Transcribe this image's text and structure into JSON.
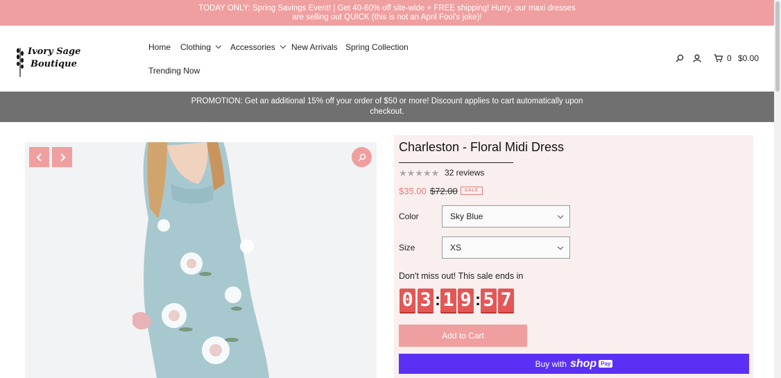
{
  "announcement": {
    "line1": "TODAY ONLY: Spring Savings Event! | Get 40-60% off site-wide + FREE shipping! Hurry, our maxi dresses",
    "line2": "are selling out QUICK (this is not an April Fool's joke)!"
  },
  "logo": {
    "line1": "Ivory Sage",
    "line2": "Boutique"
  },
  "nav": {
    "items": [
      {
        "label": "Home"
      },
      {
        "label": "Clothing",
        "has_dropdown": true
      },
      {
        "label": "Accessories",
        "has_dropdown": true
      },
      {
        "label": "New Arrivals"
      },
      {
        "label": "Spring Collection"
      },
      {
        "label": "Trending Now"
      }
    ]
  },
  "header_icons": {
    "search": "search-icon",
    "account": "user-icon",
    "cart": "cart-icon"
  },
  "cart": {
    "count": "0",
    "total": "$0.00"
  },
  "promotion": {
    "line1": "PROMOTION: Get an additional 15% off your order of $50 or more! Discount applies to cart automatically upon",
    "line2": "checkout."
  },
  "gallery": {
    "prev": "chevron-left-icon",
    "next": "chevron-right-icon",
    "zoom": "zoom-icon"
  },
  "product": {
    "title": "Charleston - Floral Midi Dress",
    "rating_stars": 5,
    "reviews": "32 reviews",
    "sale_price": "$35.00",
    "original_price": "$72.00",
    "sale_badge": "SALE",
    "options": [
      {
        "label": "Color",
        "value": "Sky Blue"
      },
      {
        "label": "Size",
        "value": "XS"
      }
    ],
    "countdown_label": "Don't miss out! This sale ends in",
    "countdown": {
      "hours": [
        "0",
        "3"
      ],
      "minutes": [
        "1",
        "9"
      ],
      "seconds": [
        "5",
        "7"
      ]
    },
    "add_to_cart": "Add to Cart",
    "buy_with": "Buy with",
    "shop_word": "shop",
    "pay_word": "Pay"
  },
  "colors": {
    "accent_pink": "#ef9f9f",
    "promo_gray": "#707070",
    "panel_bg": "#f8efee",
    "countdown_red": "#e35757",
    "shop_pay_purple": "#5a31f4"
  }
}
